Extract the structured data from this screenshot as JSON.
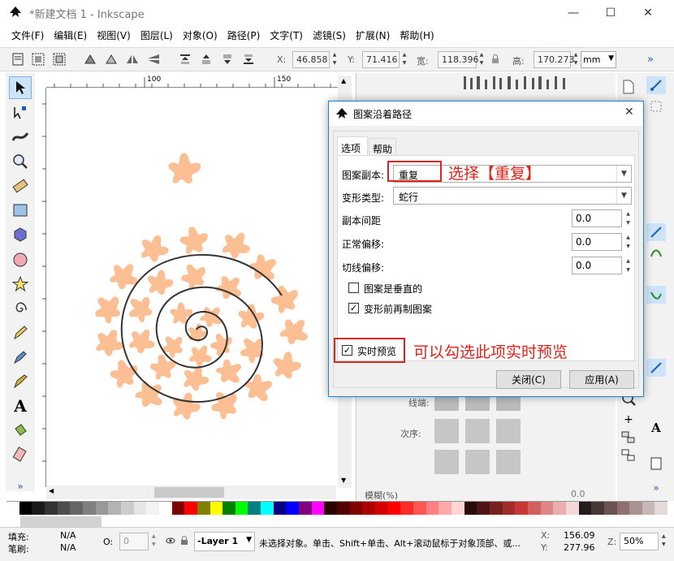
{
  "window": {
    "title": "*新建文档 1 - Inkscape",
    "minimize": "—",
    "maximize": "☐",
    "close": "✕"
  },
  "menu": [
    "文件(F)",
    "编辑(E)",
    "视图(V)",
    "图层(L)",
    "对象(O)",
    "路径(P)",
    "文字(T)",
    "滤镜(S)",
    "扩展(N)",
    "帮助(H)"
  ],
  "toolbar": {
    "x_label": "X:",
    "x_value": "46.858",
    "y_label": "Y:",
    "y_value": "71.416",
    "w_label": "宽:",
    "w_value": "118.396",
    "h_label": "高:",
    "h_value": "170.273",
    "unit": "mm",
    "more": "»"
  },
  "ruler": {
    "t100": "100",
    "t150": "150"
  },
  "dialog": {
    "title": "图案沿着路径",
    "close": "✕",
    "tabs": [
      "选项",
      "帮助"
    ],
    "pattern_copies_label": "图案副本:",
    "pattern_copies_value": "重复",
    "deform_type_label": "变形类型:",
    "deform_type_value": "蛇行",
    "spacing_label": "副本间距",
    "spacing_value": "0.0",
    "normal_offset_label": "正常偏移:",
    "normal_offset_value": "0.0",
    "tangent_offset_label": "切线偏移:",
    "tangent_offset_value": "0.0",
    "vertical_label": "图案是垂直的",
    "vertical_checked": false,
    "duplicate_label": "变形前再制图案",
    "duplicate_checked": true,
    "live_preview_label": "实时预览",
    "live_preview_checked": true,
    "close_button": "关闭(C)",
    "apply_button": "应用(A)"
  },
  "annotations": {
    "select_repeat": "选择【重复】",
    "live_preview_hint": "可以勾选此项实时预览"
  },
  "rightpanel": {
    "stroke_label": "线端:",
    "order_label": "次序:",
    "blur_label": "模糊(%)",
    "blur_value": "0.0"
  },
  "status": {
    "fill_label": "填充:",
    "fill_value": "N/A",
    "stroke_label": "笔刷:",
    "stroke_value": "N/A",
    "opacity_label": "O:",
    "opacity_value": "0",
    "layer": "-Layer 1",
    "message": "未选择对象。单击、Shift+单击、Alt+滚动鼠标于对象顶部、或...",
    "x_label": "X:",
    "x_value": "156.09",
    "y_label": "Y:",
    "y_value": "277.96",
    "z_label": "Z:",
    "zoom": "50%"
  },
  "colors": {
    "shape": "#fcbf94",
    "spiral": "#333333",
    "annotation_red": "#e0221a",
    "dialog_border": "#1883d7"
  }
}
